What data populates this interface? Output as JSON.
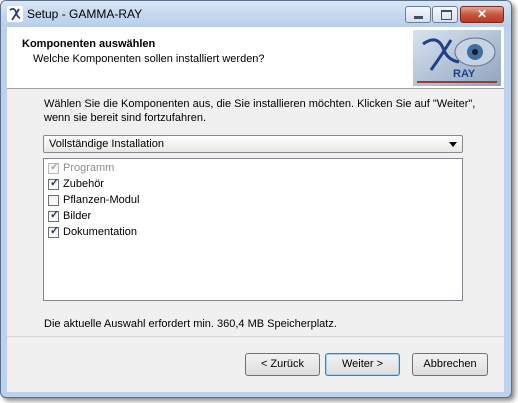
{
  "window": {
    "title": "Setup - GAMMA-RAY",
    "controls": {
      "minimize": "minimize-icon",
      "maximize": "maximize-icon",
      "close": "close-icon"
    }
  },
  "header": {
    "title": "Komponenten auswählen",
    "subtitle": "Welche Komponenten sollen installiert werden?",
    "logo_text": "RAY"
  },
  "main": {
    "intro": "Wählen Sie die Komponenten aus, die Sie installieren möchten. Klicken Sie auf \"Weiter\", wenn sie bereit sind fortzufahren.",
    "install_type": "Vollständige Installation",
    "components": [
      {
        "label": "Programm",
        "checked": true,
        "disabled": true
      },
      {
        "label": "Zubehör",
        "checked": true,
        "disabled": false
      },
      {
        "label": "Pflanzen-Modul",
        "checked": false,
        "disabled": false
      },
      {
        "label": "Bilder",
        "checked": true,
        "disabled": false
      },
      {
        "label": "Dokumentation",
        "checked": true,
        "disabled": false
      }
    ],
    "space_required": "Die aktuelle Auswahl erfordert min. 360,4 MB Speicherplatz."
  },
  "buttons": {
    "back": "< Zurück",
    "next": "Weiter >",
    "cancel": "Abbrechen"
  },
  "colors": {
    "frame": "#bcd2ec",
    "dialog_bg": "#f0f0f0",
    "check_mark": "#253c73",
    "default_button_border": "#3c7fb1"
  }
}
